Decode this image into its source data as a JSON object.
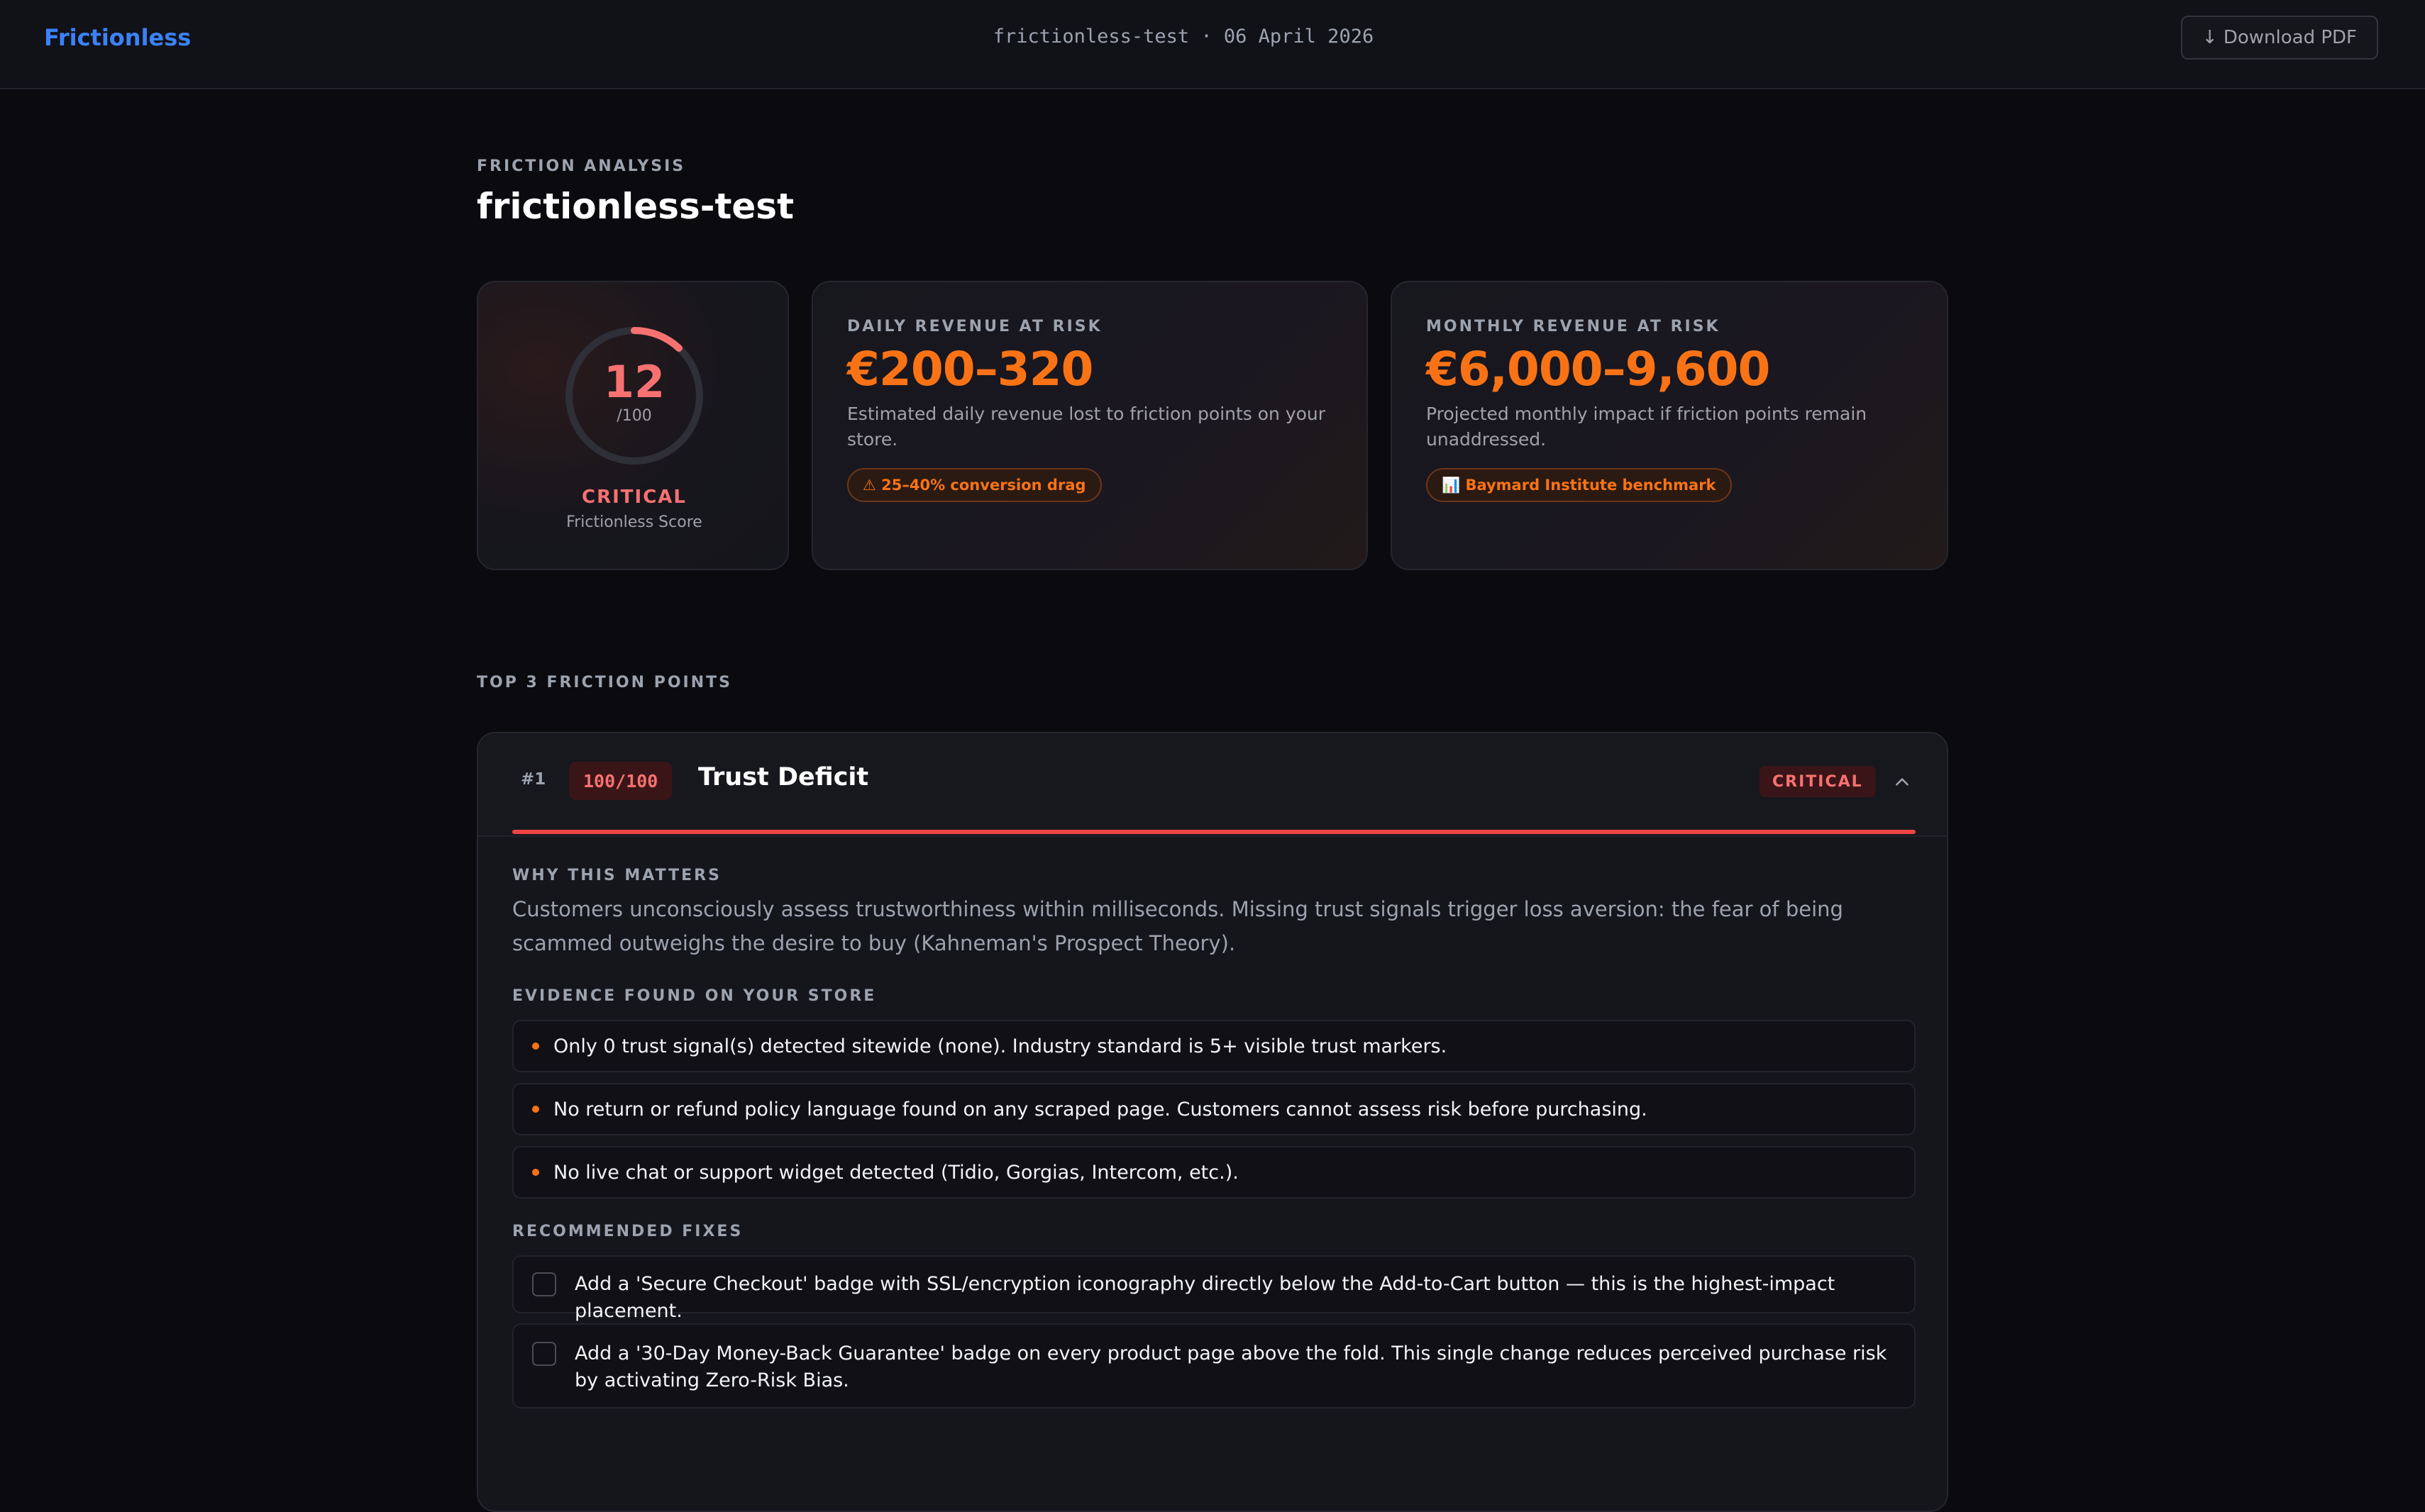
{
  "topbar": {
    "brand": "Frictionless",
    "meta": "frictionless-test · 06 April 2026",
    "download_label": "↓ Download PDF"
  },
  "header": {
    "eyebrow": "FRICTION ANALYSIS",
    "title": "frictionless-test"
  },
  "score": {
    "value": "12",
    "max": "/100",
    "fraction": 0.12,
    "status": "CRITICAL",
    "label": "Frictionless Score",
    "color": "#f87171"
  },
  "daily": {
    "eyebrow": "DAILY REVENUE AT RISK",
    "value": "€200–320",
    "description": "Estimated daily revenue lost to friction points on your store.",
    "pill": "⚠ 25–40% conversion drag"
  },
  "monthly": {
    "eyebrow": "MONTHLY REVENUE AT RISK",
    "value": "€6,000–9,600",
    "description": "Projected monthly impact if friction points remain unaddressed.",
    "pill": "📊 Baymard Institute benchmark"
  },
  "section": {
    "eyebrow": "TOP 3 FRICTION POINTS"
  },
  "friction_points": [
    {
      "rank": "#1",
      "score": "100/100",
      "title": "Trust Deficit",
      "severity": "CRITICAL",
      "why_label": "WHY THIS MATTERS",
      "why_text": "Customers unconsciously assess trustworthiness within milliseconds. Missing trust signals trigger loss aversion: the fear of being scammed outweighs the desire to buy (Kahneman's Prospect Theory).",
      "evidence_label": "EVIDENCE FOUND ON YOUR STORE",
      "evidence": [
        "Only 0 trust signal(s) detected sitewide (none). Industry standard is 5+ visible trust markers.",
        "No return or refund policy language found on any scraped page. Customers cannot assess risk before purchasing.",
        "No live chat or support widget detected (Tidio, Gorgias, Intercom, etc.)."
      ],
      "fixes_label": "RECOMMENDED FIXES",
      "fixes": [
        "Add a 'Secure Checkout' badge with SSL/encryption iconography directly below the Add-to-Cart button — this is the highest-impact placement.",
        "Add a '30-Day Money-Back Guarantee' badge on every product page above the fold. This single change reduces perceived purchase risk by activating Zero-Risk Bias."
      ]
    }
  ]
}
